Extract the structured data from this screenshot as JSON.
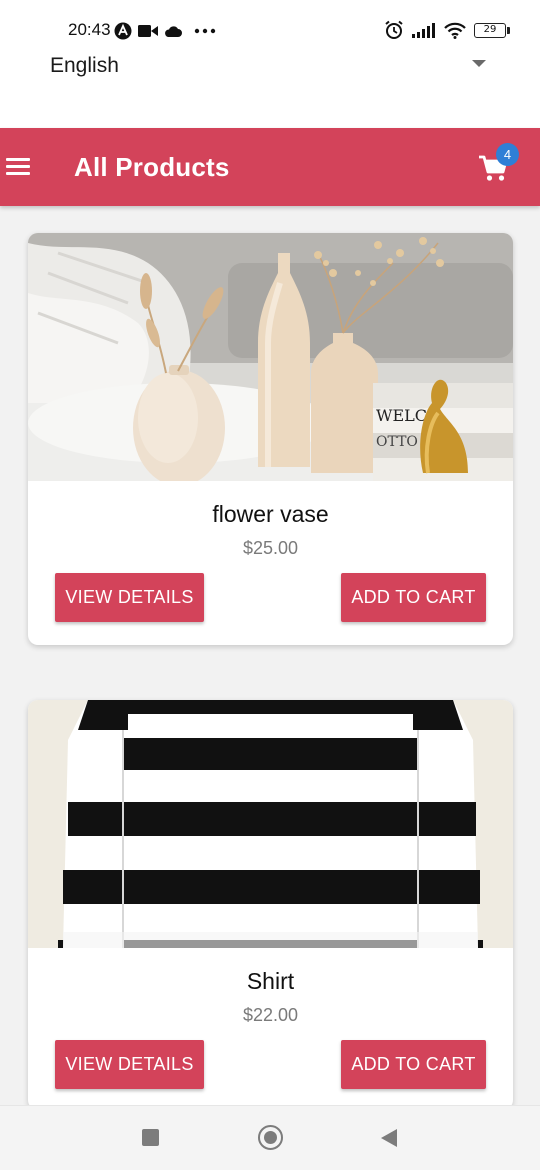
{
  "status_bar": {
    "time": "20:43",
    "battery": "29",
    "left_icons": [
      "nav-app-icon",
      "video-icon",
      "cloud-icon",
      "more-dots-icon"
    ],
    "right_icons": [
      "alarm-icon",
      "signal-icon",
      "wifi-icon",
      "battery-icon"
    ]
  },
  "language_select": {
    "value": "English"
  },
  "app_bar": {
    "title": "All Products",
    "cart_count": "4"
  },
  "colors": {
    "primary": "#d3435a",
    "badge": "#2f7fd6",
    "price": "#7a7a7a"
  },
  "products": [
    {
      "name": "flower vase",
      "price": "$25.00",
      "details_label": "VIEW DETAILS",
      "add_label": "ADD TO CART"
    },
    {
      "name": "Shirt",
      "price": "$22.00",
      "details_label": "VIEW DETAILS",
      "add_label": "ADD TO CART"
    }
  ],
  "nav_bar": {
    "icons": [
      "recents-square-icon",
      "home-circle-icon",
      "back-triangle-icon"
    ]
  }
}
